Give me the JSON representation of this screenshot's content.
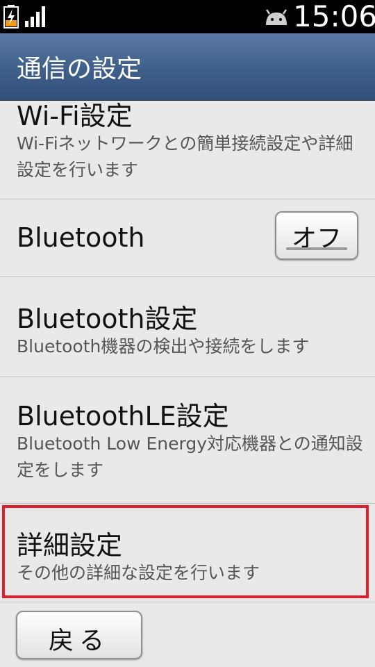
{
  "status_bar": {
    "time": "15:06",
    "icons": [
      "battery-charging-icon",
      "signal-icon",
      "android-notification-icon"
    ]
  },
  "title_bar": {
    "title": "通信の設定"
  },
  "items": [
    {
      "title": "Wi-Fi設定",
      "description": "Wi-Fiネットワークとの簡単接続設定や詳細設定を行います"
    },
    {
      "title": "Bluetooth",
      "toggle_label": "オフ"
    },
    {
      "title": "Bluetooth設定",
      "description": "Bluetooth機器の検出や接続をします"
    },
    {
      "title": "BluetoothLE設定",
      "description": "Bluetooth Low Energy対応機器との通知設定をします"
    },
    {
      "title": "詳細設定",
      "description": "その他の詳細な設定を行います"
    }
  ],
  "footer": {
    "back_label": "戻る"
  },
  "colors": {
    "highlight": "#e0202b",
    "titlebar": "#3f5f8b",
    "background": "#e9e9e9"
  }
}
